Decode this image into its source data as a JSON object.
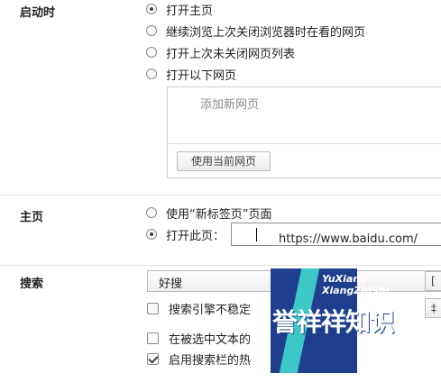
{
  "startup": {
    "label": "启动时",
    "options": [
      {
        "label": "打开主页",
        "checked": true
      },
      {
        "label": "继续浏览上次关闭浏览器时在看的网页",
        "checked": false
      },
      {
        "label": "打开上次未关闭网页列表",
        "checked": false
      },
      {
        "label": "打开以下网页",
        "checked": false
      }
    ],
    "pages_box": {
      "add_page_placeholder": "添加新网页",
      "use_current_button": "使用当前网页"
    }
  },
  "homepage": {
    "label": "主页",
    "options": [
      {
        "label": "使用“新标签页”页面",
        "checked": false
      },
      {
        "label": "打开此页：",
        "checked": true
      }
    ],
    "url_value": "https://www.baidu.com/"
  },
  "search": {
    "label": "搜索",
    "engine_selected": "好搜",
    "right_btn_1": "[",
    "right_btn_2": "‡",
    "checkboxes": [
      {
        "label": "搜索引擎不稳定",
        "checked": false
      },
      {
        "label": "在被选中文本的",
        "checked": false
      },
      {
        "label": "启用搜索栏的热",
        "checked": true
      }
    ]
  },
  "watermark": {
    "line1": "YuXiang",
    "line2": "XiangZhiShi",
    "main": "誉祥祥知识",
    "colors": {
      "panel": "#1f3f8e",
      "stripe": "#3fd0c8"
    }
  }
}
